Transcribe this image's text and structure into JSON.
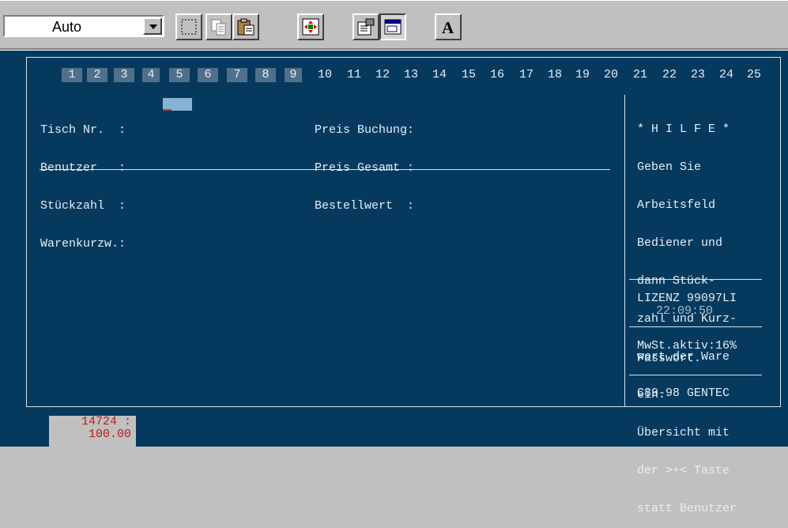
{
  "toolbar": {
    "font_size_value": "Auto",
    "buttons": [
      {
        "name": "select-icon"
      },
      {
        "name": "copy-icon"
      },
      {
        "name": "paste-icon"
      },
      {
        "name": "fullscreen-icon"
      },
      {
        "name": "properties-icon"
      },
      {
        "name": "background-icon",
        "pressed": true
      },
      {
        "name": "font-icon",
        "label": "A"
      }
    ]
  },
  "numbers": [
    "1",
    "2",
    "3",
    "4",
    "5",
    "6",
    "7",
    "8",
    "9",
    "10",
    "11",
    "12",
    "13",
    "14",
    "15",
    "16",
    "17",
    "18",
    "19",
    "20",
    "21",
    "22",
    "23",
    "24",
    "25"
  ],
  "form": {
    "left": [
      "Tisch Nr.  :",
      "Benutzer   :",
      "Stückzahl  :",
      "Warenkurzw.:"
    ],
    "right": [
      "Preis Buchung:",
      "Preis Gesamt :",
      "Bestellwert  :"
    ]
  },
  "help": {
    "lines": [
      "* H I L F E *",
      "Geben Sie",
      "Arbeitsfeld",
      "Bediener und",
      "dann Stück-",
      "zahl und Kurz-",
      "wort der Ware",
      "ein.",
      "Übersicht mit",
      "der >+< Taste",
      "statt Benutzer"
    ],
    "license": "LIZENZ 99097LI",
    "time": "22:09:50",
    "mwst": "MwSt.aktiv:16%",
    "password": "Passwort.",
    "copyright": "C89-98 GENTEC"
  },
  "status": {
    "line1": "14724 :",
    "line2": "100.00"
  },
  "colors": {
    "screen_bg": "#053a5e",
    "text": "#e6eef4",
    "number_box": "#50708a",
    "status_text": "#c01818"
  }
}
